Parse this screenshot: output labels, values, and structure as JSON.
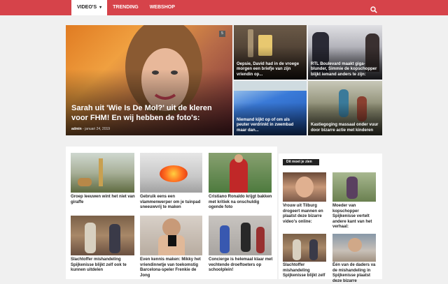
{
  "nav": {
    "items": [
      {
        "label": "VIDEO'S",
        "active": true,
        "has_dropdown": true
      },
      {
        "label": "TRENDING",
        "active": false
      },
      {
        "label": "WEBSHOP",
        "active": false
      }
    ],
    "search_icon": "search-icon",
    "brand_color": "#d6434a"
  },
  "hero": {
    "main": {
      "title": "Sarah uit 'Wie Is De Mol?' uit de kleren voor FHM! En wij hebben de foto's:",
      "author": "admin",
      "date": "januari 24, 2019",
      "badge": "5"
    },
    "tiles": [
      {
        "title": "Oepsie, David had in de vroege morgen een briefje van zijn vriendin op..."
      },
      {
        "title": "RTL Boulevard maakt giga-blunder, Simmie de kopschopper blijkt iemand anders te zijn:"
      },
      {
        "title": "Niemand kijkt op of om als peuter verdrinkt in zwembad maar dan..."
      },
      {
        "title": "Kastiegoging massaal onder vuur door bizarre actie met kinderen"
      }
    ]
  },
  "grid": [
    {
      "title": "Groep leeuwen wint het niet van giraffe"
    },
    {
      "title": "Gebruik eens een vlammenwerper om je tuinpad sneeuwvrij te maken"
    },
    {
      "title": "Cristiano Ronaldo krijgt bakken met kritiek na onschuldig ogende foto"
    },
    {
      "title": "Slachtoffer mishandeling Spijkenisse blijkt zelf ook te kunnen uitdelen"
    },
    {
      "title": "Even kennis maken: Mikky het vriendinnetje van toekomstig Barcelona-speler Frenkie de Jong"
    },
    {
      "title": "Concierge is helemaal klaar met vechtende droeftoeters op schoolplein!"
    }
  ],
  "sidebar": {
    "title": "Dit moet je zien",
    "items": [
      {
        "title": "Vrouw uit Tilburg drogeert mannen en plaatst deze bizarre video's online:"
      },
      {
        "title": "Moeder van kopschopper Spijkenisse vertelt andere kant van het verhaal:"
      },
      {
        "title": "Slachtoffer mishandeling Spijkenisse blijkt zelf"
      },
      {
        "title": "Één van de daders va de mishandeling in Spijkenisse plaatst deze bizarre"
      }
    ]
  }
}
